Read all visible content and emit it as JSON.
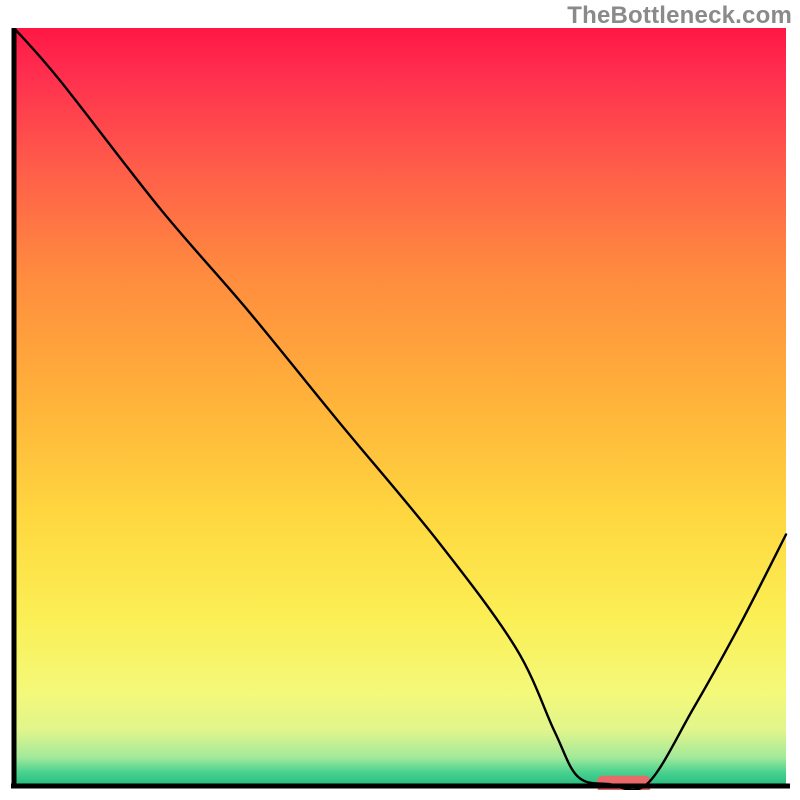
{
  "watermark": {
    "text": "TheBottleneck.com"
  },
  "chart_data": {
    "type": "line",
    "title": "",
    "xlabel": "",
    "ylabel": "",
    "xlim": [
      0,
      100
    ],
    "ylim": [
      0,
      100
    ],
    "grid": false,
    "legend": false,
    "annotations": [],
    "background_gradient": {
      "stops": [
        {
          "offset": 0.0,
          "color": "#ff1744"
        },
        {
          "offset": 0.06,
          "color": "#ff2e4f"
        },
        {
          "offset": 0.18,
          "color": "#ff5b4a"
        },
        {
          "offset": 0.32,
          "color": "#ff8a3f"
        },
        {
          "offset": 0.5,
          "color": "#ffb43a"
        },
        {
          "offset": 0.65,
          "color": "#ffd840"
        },
        {
          "offset": 0.78,
          "color": "#fbef55"
        },
        {
          "offset": 0.88,
          "color": "#f4f97a"
        },
        {
          "offset": 0.93,
          "color": "#dff58c"
        },
        {
          "offset": 0.965,
          "color": "#a2e99a"
        },
        {
          "offset": 0.985,
          "color": "#47d18f"
        },
        {
          "offset": 1.0,
          "color": "#2bbf80"
        }
      ]
    },
    "series": [
      {
        "name": "bottleneck-curve",
        "type": "line",
        "stroke": "#000000",
        "stroke_width": 2,
        "x": [
          0,
          6,
          19,
          30,
          42,
          55,
          65,
          70,
          73,
          77,
          82,
          88,
          94,
          100
        ],
        "values": [
          100,
          93,
          76,
          63,
          48,
          32,
          18,
          7,
          1,
          0,
          0,
          10,
          21,
          33
        ]
      }
    ],
    "marker": {
      "name": "optimal-range",
      "x_center": 79,
      "y": 0,
      "width_x_units": 7,
      "height_y_units": 2.2,
      "color": "#e86a6a",
      "rx": 6
    }
  }
}
